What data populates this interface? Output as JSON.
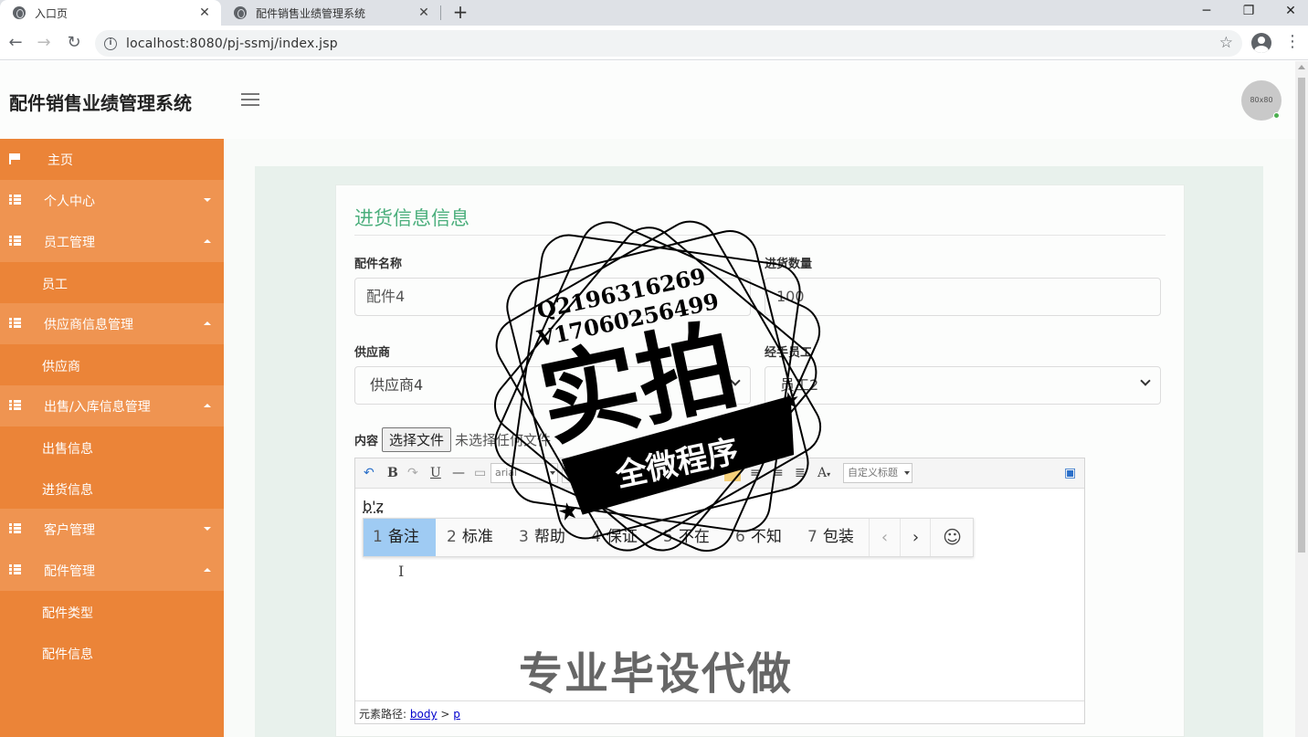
{
  "browser": {
    "tabs": [
      {
        "title": "入口页",
        "active": true
      },
      {
        "title": "配件销售业绩管理系统",
        "active": false
      }
    ],
    "url": "localhost:8080/pj-ssmj/index.jsp",
    "info_icon": "i"
  },
  "header": {
    "brand": "配件销售业绩管理系统",
    "avatar_text": "80x80"
  },
  "sidebar": {
    "home": "主页",
    "groups": [
      {
        "label": "个人中心",
        "expanded": false,
        "children": []
      },
      {
        "label": "员工管理",
        "expanded": true,
        "children": [
          "员工"
        ]
      },
      {
        "label": "供应商信息管理",
        "expanded": true,
        "children": [
          "供应商"
        ]
      },
      {
        "label": "出售/入库信息管理",
        "expanded": true,
        "children": [
          "出售信息",
          "进货信息"
        ]
      },
      {
        "label": "客户管理",
        "expanded": false,
        "children": []
      },
      {
        "label": "配件管理",
        "expanded": true,
        "children": [
          "配件类型",
          "配件信息"
        ]
      }
    ]
  },
  "form": {
    "title": "进货信息信息",
    "part_name_label": "配件名称",
    "part_name_value": "配件4",
    "quantity_label": "进货数量",
    "quantity_value": "100",
    "supplier_label": "供应商",
    "supplier_value": "供应商4",
    "handler_label": "经手员工",
    "handler_value": "员工2",
    "content_label": "内容",
    "file_button": "选择文件",
    "file_status": "未选择任何文件"
  },
  "editor": {
    "font_family": "arial",
    "font_size": "16px",
    "heading": "自定义标题",
    "content": "b'z",
    "path_label": "元素路径:",
    "path_body": "body",
    "path_sep": ">",
    "path_p": "p"
  },
  "ime": {
    "candidates": [
      {
        "num": "1",
        "text": "备注",
        "selected": true
      },
      {
        "num": "2",
        "text": "标准"
      },
      {
        "num": "3",
        "text": "帮助"
      },
      {
        "num": "4",
        "text": "保证"
      },
      {
        "num": "5",
        "text": "不在"
      },
      {
        "num": "6",
        "text": "不知"
      },
      {
        "num": "7",
        "text": "包装"
      }
    ],
    "prev": "‹",
    "next": "›",
    "emoji": "☺"
  },
  "watermark": {
    "qq": "Q2196316269",
    "wechat": "V17060256499",
    "big": "实拍",
    "ribbon": "全微程序",
    "bottom": "专业毕设代做"
  },
  "colors": {
    "sidebar": "#eb8438",
    "sidebar_group": "#ef9451",
    "accent_title": "#4caf7d",
    "ime_selected": "#9fcbf3"
  }
}
